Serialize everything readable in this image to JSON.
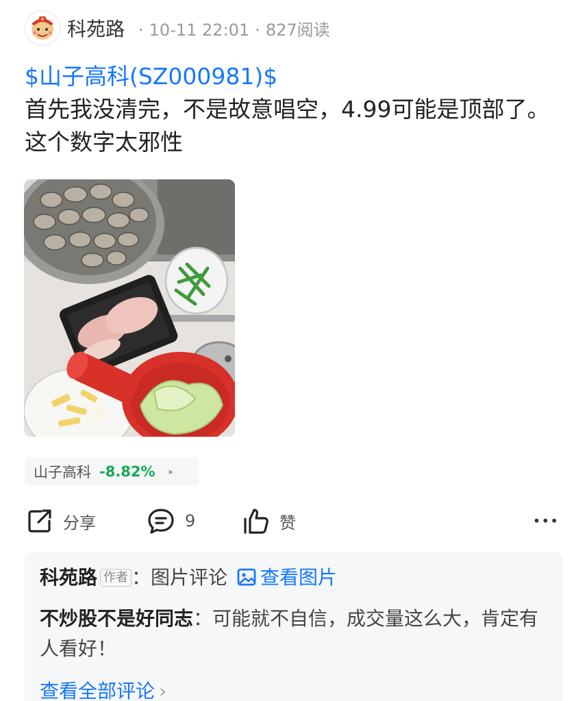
{
  "post": {
    "author": "科苑路",
    "time": "10-11 22:01",
    "views": "827阅读",
    "meta_separator": "·",
    "stock_link": "$山子高科(SZ000981)$",
    "text": "首先我没清完，不是故意唱空，4.99可能是顶部了。这个数字太邪性",
    "avatar_icon": "fortune-god-avatar-icon",
    "image_icon": "food-photo"
  },
  "stock_chip": {
    "name": "山子高科",
    "change": "-8.82%",
    "change_color": "#18a957",
    "arrow": "▸"
  },
  "actions": {
    "share": "分享",
    "comment_count": "9",
    "like": "赞",
    "more": "•••"
  },
  "comments": {
    "items": [
      {
        "author": "科苑路",
        "badge": "作者",
        "colon": "：",
        "text": "图片评论",
        "link": "查看图片",
        "link_icon": "image-icon"
      },
      {
        "author": "不炒股不是好同志",
        "colon": "：",
        "text": "可能就不自信，成交量这么大，肯定有人看好！"
      }
    ],
    "view_all": "查看全部评论",
    "view_all_chevron": "›"
  },
  "colors": {
    "link_blue": "#1677ff",
    "down_green": "#18a957",
    "meta_gray": "#999999"
  }
}
